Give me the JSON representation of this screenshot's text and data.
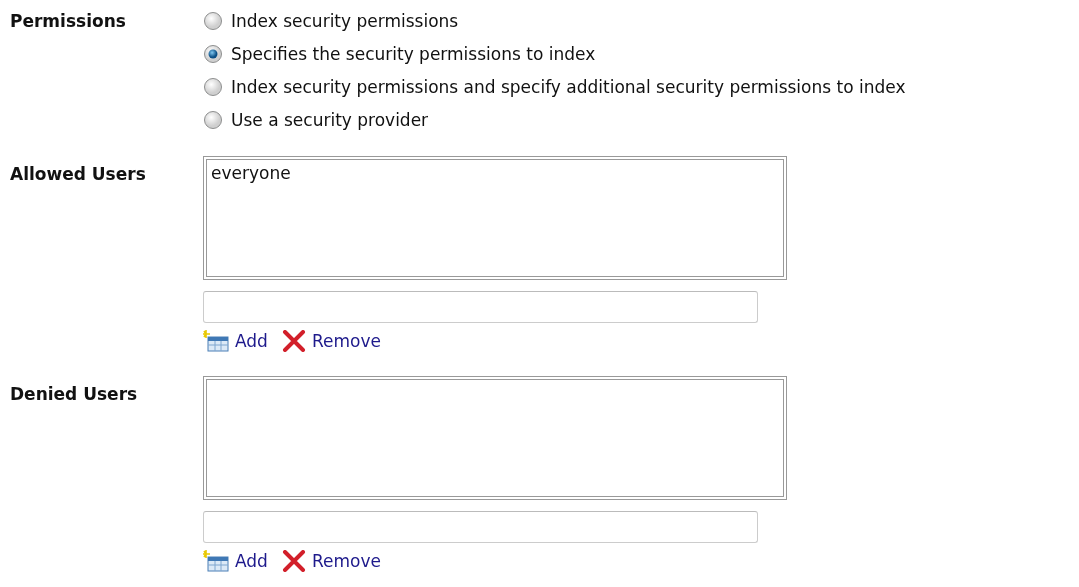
{
  "permissions": {
    "label": "Permissions",
    "options": [
      {
        "label": "Index security permissions",
        "selected": false
      },
      {
        "label": "Specifies the security permissions to index",
        "selected": true
      },
      {
        "label": "Index security permissions and specify additional security permissions to index",
        "selected": false
      },
      {
        "label": "Use a security provider",
        "selected": false
      }
    ]
  },
  "user_lists": [
    {
      "label": "Allowed Users",
      "items": [
        "everyone"
      ],
      "add": "Add",
      "remove": "Remove"
    },
    {
      "label": "Denied Users",
      "add": "Add",
      "remove": "Remove"
    }
  ]
}
